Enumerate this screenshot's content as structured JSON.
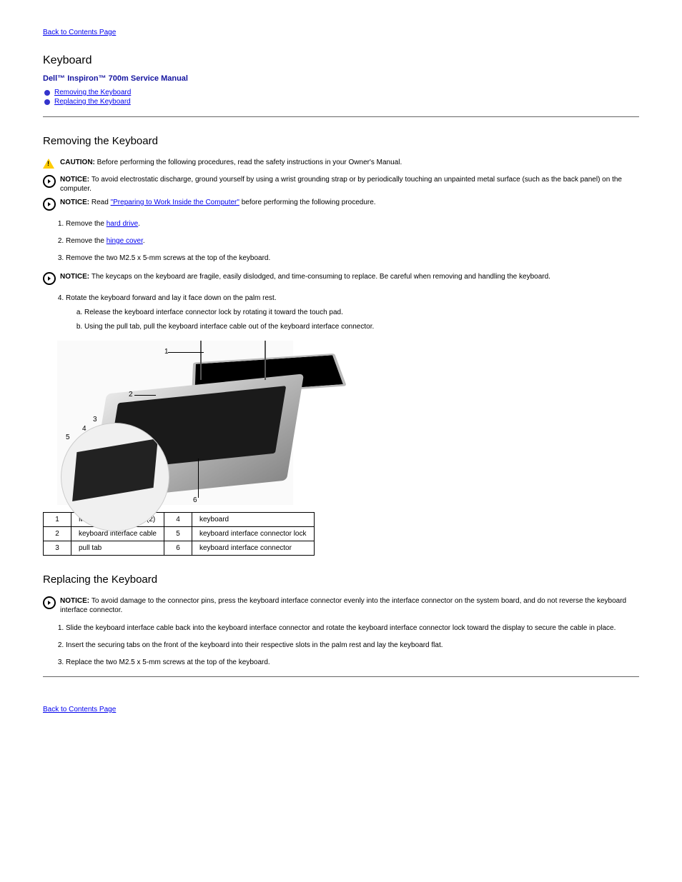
{
  "nav": {
    "back_link": "Back to Contents Page"
  },
  "header": {
    "page_title": "Keyboard",
    "manual_title": "Dell™ Inspiron™ 700m Service Manual"
  },
  "toc": {
    "item1": "Removing the Keyboard",
    "item2": "Replacing the Keyboard"
  },
  "removing": {
    "title": "Removing the Keyboard",
    "caution_label": "CAUTION: ",
    "caution_text": "Before performing the following procedures, read the safety instructions in your Owner's Manual.",
    "notice1_label": "NOTICE: ",
    "notice1_text": "To avoid electrostatic discharge, ground yourself by using a wrist grounding strap or by periodically touching an unpainted metal surface (such as the back panel) on the computer.",
    "notice2_label": "NOTICE: ",
    "notice2_text_a": "Read ",
    "notice2_link": "\"Preparing to Work Inside the Computer\"",
    "notice2_text_b": " before performing the following procedure.",
    "step1_a": "Remove the ",
    "step1_link": "hard drive",
    "step1_b": ".",
    "step2_a": "Remove the ",
    "step2_link": "hinge cover",
    "step2_b": ".",
    "step3": "Remove the two M2.5 x 5-mm screws at the top of the keyboard.",
    "notice3_label": "NOTICE: ",
    "notice3_text": "The keycaps on the keyboard are fragile, easily dislodged, and time-consuming to replace. Be careful when removing and handling the keyboard.",
    "step4": "Rotate the keyboard forward and lay it face down on the palm rest.",
    "step4a": "Release the keyboard interface connector lock by rotating it toward the touch pad.",
    "step4b": "Using the pull tab, pull the keyboard interface cable out of the keyboard interface connector.",
    "parts": {
      "n1_label": "M2.5 x 5-mm screws (2)",
      "n2_label": "keyboard interface cable",
      "n3_label": "pull tab",
      "n4_label": "keyboard",
      "n5_label": "keyboard interface connector lock",
      "n6_label": "keyboard interface connector"
    }
  },
  "replacing": {
    "title": "Replacing the Keyboard",
    "notice_label": "NOTICE: ",
    "notice_text": "To avoid damage to the connector pins, press the keyboard interface connector evenly into the interface connector on the system board, and do not reverse the keyboard interface connector.",
    "step1": "Slide the keyboard interface cable back into the keyboard interface connector and rotate the keyboard interface connector lock toward the display to secure the cable in place.",
    "step2": "Insert the securing tabs on the front of the keyboard into their respective slots in the palm rest and lay the keyboard flat.",
    "step3": "Replace the two M2.5 x 5-mm screws at the top of the keyboard."
  }
}
